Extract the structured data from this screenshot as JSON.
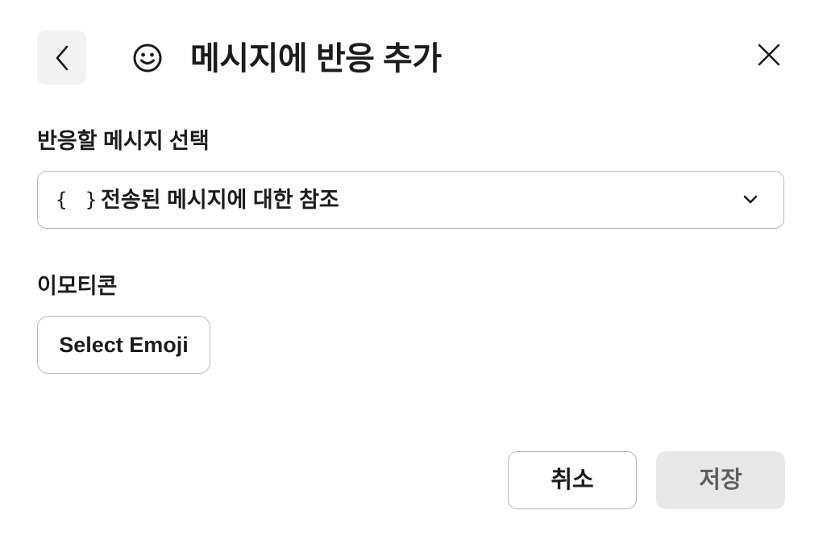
{
  "header": {
    "title": "메시지에 반응 추가",
    "back_icon": "chevron-left-icon",
    "title_icon": "smiley-icon",
    "close_icon": "close-icon"
  },
  "message_select": {
    "label": "반응할 메시지 선택",
    "prefix_icon": "{ }",
    "value": "전송된 메시지에 대한 참조",
    "chevron_icon": "chevron-down-icon"
  },
  "emoji": {
    "label": "이모티콘",
    "button_label": "Select Emoji"
  },
  "footer": {
    "cancel_label": "취소",
    "save_label": "저장"
  }
}
